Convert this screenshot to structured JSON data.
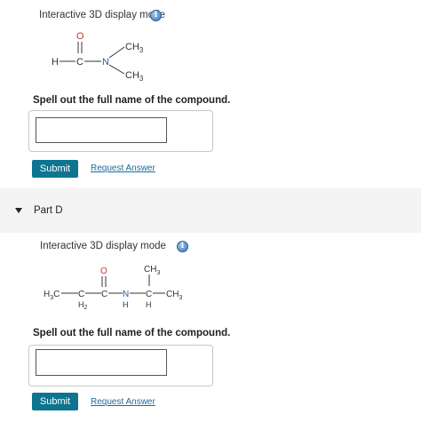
{
  "part_c": {
    "mode_label": "Interactive 3D display mode",
    "info_glyph": "i",
    "prompt": "Spell out the full name of the compound.",
    "answer_value": "",
    "submit_label": "Submit",
    "request_label": "Request Answer",
    "structure": {
      "H": "H",
      "C": "C",
      "O": "O",
      "N": "N",
      "CH3_top": "CH",
      "CH3_top_sub": "3",
      "CH3_bottom": "CH",
      "CH3_bottom_sub": "3"
    }
  },
  "part_d": {
    "title": "Part D",
    "mode_label": "Interactive 3D display mode",
    "info_glyph": "i",
    "prompt": "Spell out the full name of the compound.",
    "answer_value": "",
    "submit_label": "Submit",
    "request_label": "Request Answer",
    "structure": {
      "H3C": "H",
      "H3C_sub": "3",
      "H3C_tail": "C",
      "C1": "C",
      "C1_sub_label": "H",
      "C1_sub": "2",
      "O": "O",
      "C2": "C",
      "N": "N",
      "N_H": "H",
      "C3": "C",
      "C3_H": "H",
      "CH3_top": "CH",
      "CH3_top_sub": "3",
      "CH3_right": "CH",
      "CH3_right_sub": "3"
    }
  },
  "colors": {
    "submit_bg": "#0e7490",
    "link": "#1d6a9c",
    "info_icon": "#3a78b8",
    "part_band": "#f4f4f4"
  }
}
